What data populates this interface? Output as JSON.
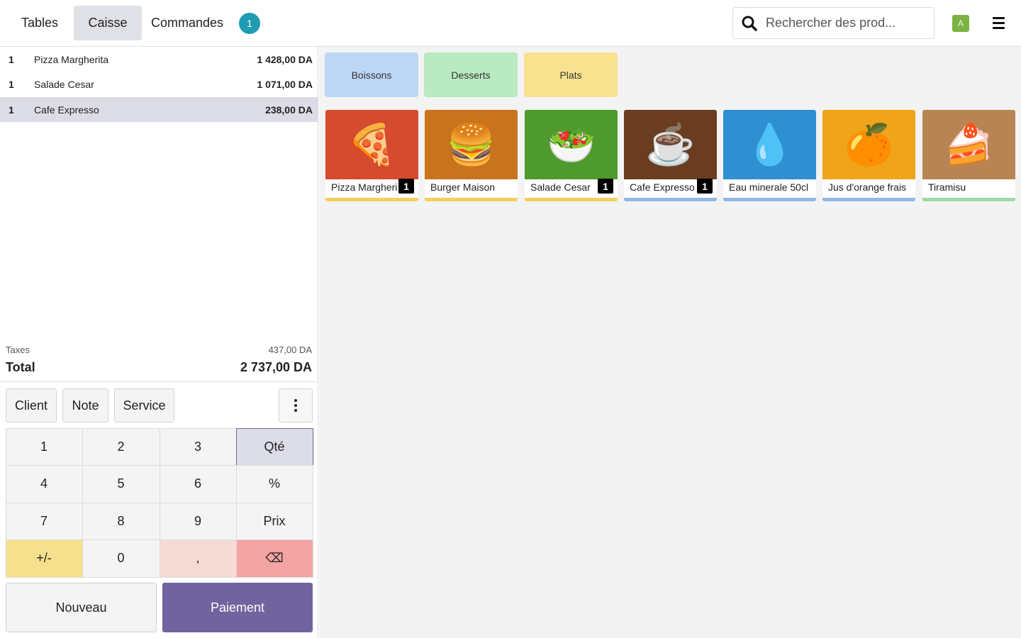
{
  "header": {
    "tabs": [
      {
        "label": "Tables",
        "active": false
      },
      {
        "label": "Caisse",
        "active": true
      },
      {
        "label": "Commandes",
        "active": false
      }
    ],
    "orders_badge": "1",
    "search_placeholder": "Rechercher des prod...",
    "avatar_letter": "A"
  },
  "order": {
    "lines": [
      {
        "qty": "1",
        "name": "Pizza Margherita",
        "price": "1 428,00 DA",
        "selected": false
      },
      {
        "qty": "1",
        "name": "Salade Cesar",
        "price": "1 071,00 DA",
        "selected": false
      },
      {
        "qty": "1",
        "name": "Cafe Expresso",
        "price": "238,00 DA",
        "selected": true
      }
    ],
    "taxes_label": "Taxes",
    "taxes_value": "437,00 DA",
    "total_label": "Total",
    "total_value": "2 737,00 DA"
  },
  "controls": {
    "client": "Client",
    "note": "Note",
    "service": "Service"
  },
  "numpad": {
    "keys": [
      "1",
      "2",
      "3",
      "Qté",
      "4",
      "5",
      "6",
      "%",
      "7",
      "8",
      "9",
      "Prix",
      "+/-",
      "0",
      ",",
      "⌫"
    ]
  },
  "actions": {
    "new": "Nouveau",
    "pay": "Paiement"
  },
  "categories": [
    {
      "label": "Boissons",
      "color": "#bcd7f6"
    },
    {
      "label": "Desserts",
      "color": "#b9eac1"
    },
    {
      "label": "Plats",
      "color": "#f8e28f"
    }
  ],
  "products": [
    {
      "name": "Pizza Margherita",
      "display": "Pizza Margheri",
      "badge": "1",
      "icon": "🍕",
      "bg": "#d64a2f",
      "bar": "#f5cf5c"
    },
    {
      "name": "Burger Maison",
      "display": "Burger Maison",
      "badge": "",
      "icon": "🍔",
      "bg": "#c9731c",
      "bar": "#f5cf5c"
    },
    {
      "name": "Salade Cesar",
      "display": "Salade Cesar",
      "badge": "1",
      "icon": "🥗",
      "bg": "#4f9a2c",
      "bar": "#f5cf5c"
    },
    {
      "name": "Cafe Expresso",
      "display": "Cafe Expresso",
      "badge": "1",
      "icon": "☕",
      "bg": "#6a3c20",
      "bar": "#93b7e8"
    },
    {
      "name": "Eau minerale 50cl",
      "display": "Eau minerale 50cl",
      "badge": "",
      "icon": "💧",
      "bg": "#2e8fd1",
      "bar": "#93b7e8"
    },
    {
      "name": "Jus d'orange frais",
      "display": "Jus d'orange frais",
      "badge": "",
      "icon": "🍊",
      "bg": "#efa419",
      "bar": "#93b7e8"
    },
    {
      "name": "Tiramisu",
      "display": "Tiramisu",
      "badge": "",
      "icon": "🍰",
      "bg": "#b98453",
      "bar": "#9ed8a5"
    }
  ]
}
